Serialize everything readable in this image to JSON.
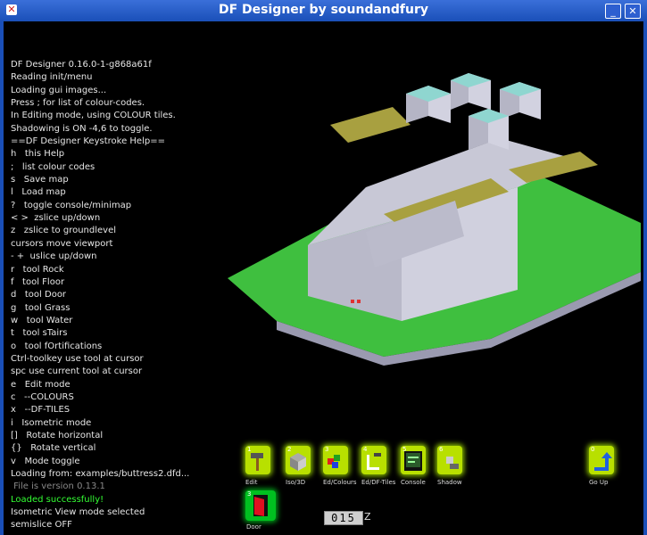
{
  "window": {
    "title": "DF Designer by soundandfury",
    "minimize": "_",
    "maximize": "□",
    "close": "✕"
  },
  "console": {
    "lines": [
      {
        "text": "DF Designer 0.16.0-1-g868a61f",
        "style": ""
      },
      {
        "text": "Reading init/menu",
        "style": ""
      },
      {
        "text": "Loading gui images...",
        "style": ""
      },
      {
        "text": "Press ; for list of colour-codes.",
        "style": ""
      },
      {
        "text": "In Editing mode, using COLOUR tiles.",
        "style": ""
      },
      {
        "text": "Shadowing is ON -4,6 to toggle.",
        "style": ""
      },
      {
        "text": "==DF Designer Keystroke Help==",
        "style": ""
      },
      {
        "text": "h   this Help",
        "style": ""
      },
      {
        "text": ";   list colour codes",
        "style": ""
      },
      {
        "text": "s   Save map",
        "style": ""
      },
      {
        "text": "l   Load map",
        "style": ""
      },
      {
        "text": "?   toggle console/minimap",
        "style": ""
      },
      {
        "text": "< >  zslice up/down",
        "style": ""
      },
      {
        "text": "z   zslice to groundlevel",
        "style": ""
      },
      {
        "text": "cursors move viewport",
        "style": ""
      },
      {
        "text": "- +  uslice up/down",
        "style": ""
      },
      {
        "text": "r   tool Rock",
        "style": ""
      },
      {
        "text": "f   tool Floor",
        "style": ""
      },
      {
        "text": "d   tool Door",
        "style": ""
      },
      {
        "text": "g   tool Grass",
        "style": ""
      },
      {
        "text": "w   tool Water",
        "style": ""
      },
      {
        "text": "t   tool sTairs",
        "style": ""
      },
      {
        "text": "o   tool fOrtifications",
        "style": ""
      },
      {
        "text": "Ctrl-toolkey use tool at cursor",
        "style": ""
      },
      {
        "text": "spc use current tool at cursor",
        "style": ""
      },
      {
        "text": "e   Edit mode",
        "style": ""
      },
      {
        "text": "c   --COLOURS",
        "style": ""
      },
      {
        "text": "x   --DF-TILES",
        "style": ""
      },
      {
        "text": "i   Isometric mode",
        "style": ""
      },
      {
        "text": "[]   Rotate horizontal",
        "style": ""
      },
      {
        "text": "{}   Rotate vertical",
        "style": ""
      },
      {
        "text": "v   Mode toggle",
        "style": ""
      },
      {
        "text": "Loading from: examples/buttress2.dfd...",
        "style": ""
      },
      {
        "text": " File is version 0.13.1",
        "style": "dim"
      },
      {
        "text": "Loaded successfully!",
        "style": "green"
      },
      {
        "text": "Isometric View mode selected",
        "style": ""
      },
      {
        "text": "semislice OFF",
        "style": ""
      }
    ]
  },
  "toolbar": {
    "tools": [
      {
        "num": "1",
        "label": "Edit",
        "icon": "hammer-icon"
      },
      {
        "num": "2",
        "label": "Iso/3D",
        "icon": "cube-icon"
      },
      {
        "num": "3",
        "label": "Ed/Colours",
        "icon": "colour-blocks-icon"
      },
      {
        "num": "4",
        "label": "Ed/DF-Tiles",
        "icon": "tiles-hammer-icon"
      },
      {
        "num": "5",
        "label": "Console",
        "icon": "console-icon"
      },
      {
        "num": "6",
        "label": "Shadow",
        "icon": "shadow-icon"
      },
      {
        "num": "0",
        "label": "Go Up",
        "icon": "arrow-up-icon"
      }
    ],
    "door": {
      "num": "3",
      "label": "Door",
      "icon": "door-icon"
    },
    "zslice": {
      "value": "015",
      "axis": "Z"
    }
  },
  "colors": {
    "titlebar": "#2a5fd0",
    "tool_active": "#b8e000",
    "door_active": "#00c020",
    "grass": "#3fbf3f",
    "stone": "#c8c8d6",
    "floor": "#a8a040"
  }
}
